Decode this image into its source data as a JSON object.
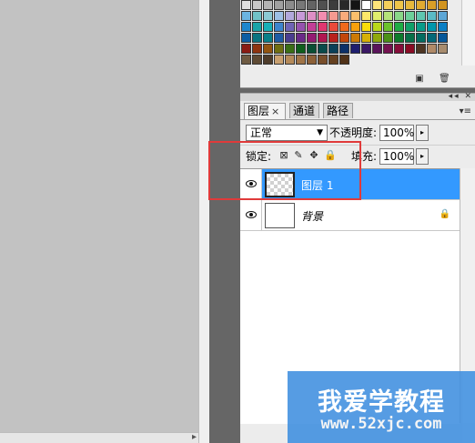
{
  "swatches": {
    "rows": [
      [
        "#e0e0e0",
        "#c8c8c8",
        "#b4b4b4",
        "#a0a0a0",
        "#8c8c8c",
        "#787878",
        "#646464",
        "#505050",
        "#3c3c3c",
        "#282828",
        "#141414",
        "#ffffff",
        "#fde47a",
        "#f5cf5b",
        "#eec44a",
        "#e7b83c",
        "#e0ab31",
        "#d99f27",
        "#d2941f"
      ],
      [
        "#6bb4e0",
        "#71c2c8",
        "#8ccad4",
        "#9ec0e6",
        "#b2a8dc",
        "#c79ad8",
        "#dd8fc5",
        "#f28db0",
        "#f59a90",
        "#f8ab7b",
        "#fbbf6c",
        "#fde769",
        "#e0ed6c",
        "#b6e27a",
        "#8ad788",
        "#6cd09a",
        "#5fc6b0",
        "#5abac6",
        "#5ca6d6"
      ],
      [
        "#1d86cc",
        "#1aa4a8",
        "#18b0b8",
        "#3d84cc",
        "#6e64b6",
        "#9552ae",
        "#c23f96",
        "#e03670",
        "#ea4a3a",
        "#f06a1c",
        "#f8a10d",
        "#f9dd0b",
        "#b9d81b",
        "#6cc12d",
        "#1eab45",
        "#10a069",
        "#0a9c8a",
        "#0096ac",
        "#0a7fc4"
      ],
      [
        "#0c5ea4",
        "#0a7480",
        "#098088",
        "#1f5ca4",
        "#4a3e90",
        "#6a2b88",
        "#941c72",
        "#b01650",
        "#b8211c",
        "#c2460a",
        "#cc7a06",
        "#d6b006",
        "#8fa80d",
        "#4b9018",
        "#0c7a2c",
        "#077048",
        "#046c60",
        "#036878",
        "#06589a"
      ],
      [
        "#8a1c14",
        "#8e3410",
        "#925410",
        "#6e6e12",
        "#3a6e16",
        "#0e5e1c",
        "#0a4e34",
        "#0a4a4a",
        "#0a4058",
        "#0c3068",
        "#1e1e6e",
        "#3a1864",
        "#5a145a",
        "#741250",
        "#860e3a",
        "#8a0c24",
        "#4d3522",
        "#b08a68",
        "#a88c6e"
      ],
      [
        "#6e5a42",
        "#5e4a34",
        "#4e3c2a",
        "#c8a070",
        "#b48a5a",
        "#a07448",
        "#8c6038",
        "#784e2a",
        "#644020",
        "#503218"
      ]
    ]
  },
  "layers_panel": {
    "tabs": [
      {
        "label": "图层",
        "close": "×",
        "active": true
      },
      {
        "label": "通道",
        "active": false
      },
      {
        "label": "路径",
        "active": false
      }
    ],
    "blend_mode": "正常",
    "opacity_label": "不透明度:",
    "opacity_value": "100%",
    "lock_label": "锁定:",
    "fill_label": "填充:",
    "fill_value": "100%",
    "layers": [
      {
        "name": "图层 1",
        "selected": true,
        "visible": true,
        "transparent": true,
        "locked": false
      },
      {
        "name": "背景",
        "selected": false,
        "visible": true,
        "transparent": false,
        "locked": true
      }
    ]
  },
  "watermark": {
    "title": "我爱学教程",
    "url": "www.52xjc.com",
    "color": "#3f8fe0"
  },
  "highlight_color": "#e03a3a"
}
